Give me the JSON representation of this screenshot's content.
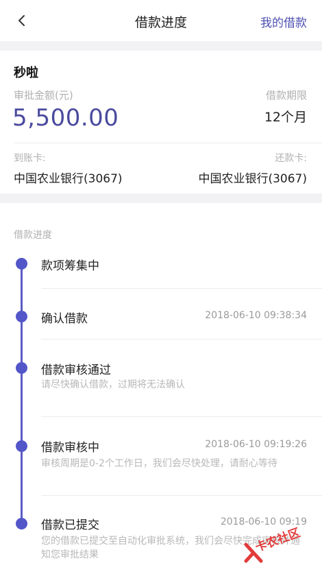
{
  "nav": {
    "title": "借款进度",
    "right_link": "我的借款"
  },
  "summary": {
    "product": "秒啦",
    "amount_label": "审批金额(元)",
    "amount": "5,500.00",
    "term_label": "借款期限",
    "term": "12个月",
    "arrive_label": "到账卡:",
    "arrive_card": "中国农业银行(3067)",
    "repay_label": "还款卡:",
    "repay_card": "中国农业银行(3067)"
  },
  "progress": {
    "section_title": "借款进度",
    "steps": [
      {
        "title": "款项筹集中",
        "time": "",
        "desc": ""
      },
      {
        "title": "确认借款",
        "time": "2018-06-10 09:38:34",
        "desc": ""
      },
      {
        "title": "借款审核通过",
        "time": "",
        "desc": "请尽快确认借款，过期将无法确认"
      },
      {
        "title": "借款审核中",
        "time": "2018-06-10 09:19:26",
        "desc": "审核周期是0-2个工作日，我们会尽快处理，请耐心等待"
      },
      {
        "title": "借款已提交",
        "time": "2018-06-10 09:19",
        "desc": "您的借款已提交至自动化审批系统，我们会尽快完成审核并通知您审批结果"
      }
    ]
  },
  "colors": {
    "accent": "#4e4fb0",
    "timeline": "#5356c8",
    "page_bg": "#f2f2f4"
  },
  "icons": {
    "back": "chevron-left-icon",
    "watermark": "logo-icon"
  },
  "watermark": {
    "text": "卡农社区"
  }
}
